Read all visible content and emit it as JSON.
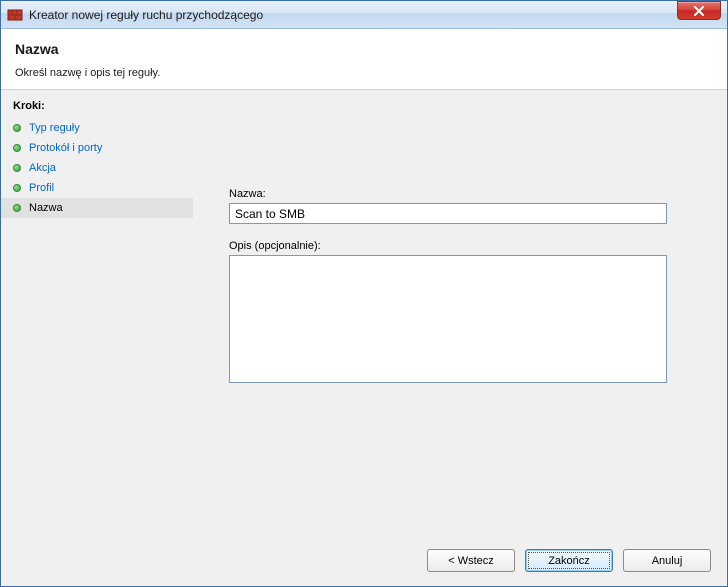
{
  "window": {
    "title": "Kreator nowej reguły ruchu przychodzącego"
  },
  "header": {
    "heading": "Nazwa",
    "subtitle": "Określ nazwę i opis tej reguły."
  },
  "sidebar": {
    "title": "Kroki:",
    "items": [
      {
        "label": "Typ reguły",
        "state": "link"
      },
      {
        "label": "Protokół i porty",
        "state": "link"
      },
      {
        "label": "Akcja",
        "state": "link"
      },
      {
        "label": "Profil",
        "state": "link"
      },
      {
        "label": "Nazwa",
        "state": "current"
      }
    ]
  },
  "form": {
    "name_label": "Nazwa:",
    "name_value": "Scan to SMB",
    "desc_label": "Opis (opcjonalnie):",
    "desc_value": ""
  },
  "buttons": {
    "back": "< Wstecz",
    "finish": "Zakończ",
    "cancel": "Anuluj"
  }
}
